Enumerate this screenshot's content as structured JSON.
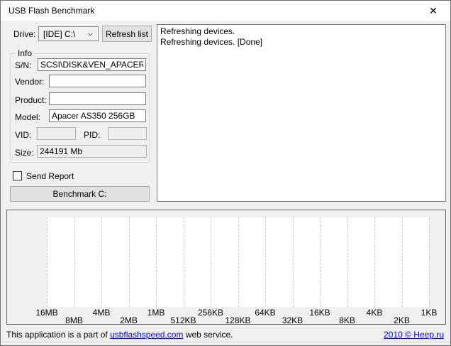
{
  "window": {
    "title": "USB Flash Benchmark",
    "close_icon": "✕"
  },
  "toolbar": {
    "drive_label": "Drive:",
    "drive_value": "[IDE] C:\\",
    "refresh_button": "Refresh list"
  },
  "info": {
    "group_title": "Info",
    "sn_label": "S/N:",
    "sn_value": "SCSI\\DISK&VEN_APACER&PR",
    "vendor_label": "Vendor:",
    "vendor_value": "",
    "product_label": "Product:",
    "product_value": "",
    "model_label": "Model:",
    "model_value": "Apacer AS350 256GB",
    "vid_label": "VID:",
    "vid_value": "",
    "pid_label": "PID:",
    "pid_value": "",
    "size_label": "Size:",
    "size_value": "244191 Mb"
  },
  "send_report": {
    "label": "Send Report",
    "checked": false
  },
  "benchmark_button_label": "Benchmark C:",
  "log": {
    "lines": [
      "Refreshing devices.",
      "Refreshing devices. [Done]"
    ]
  },
  "chart_data": {
    "type": "line",
    "title": "",
    "x_categories": [
      "16MB",
      "8MB",
      "4MB",
      "2MB",
      "1MB",
      "512KB",
      "256KB",
      "128KB",
      "64KB",
      "32KB",
      "16KB",
      "8KB",
      "4KB",
      "2KB",
      "1KB"
    ],
    "series": [],
    "grid": "vertical-dashed",
    "legend": "none"
  },
  "status_bar": {
    "prefix": "This application is a part of ",
    "link_text": "usbflashspeed.com",
    "suffix": " web service.",
    "copyright_link": "2010 © Heep.ru"
  },
  "colors": {
    "client_bg": "#f0f0f0",
    "link_blue": "#0000ee",
    "field_border": "#7a7a7a",
    "gridline": "#c9c9c9"
  }
}
